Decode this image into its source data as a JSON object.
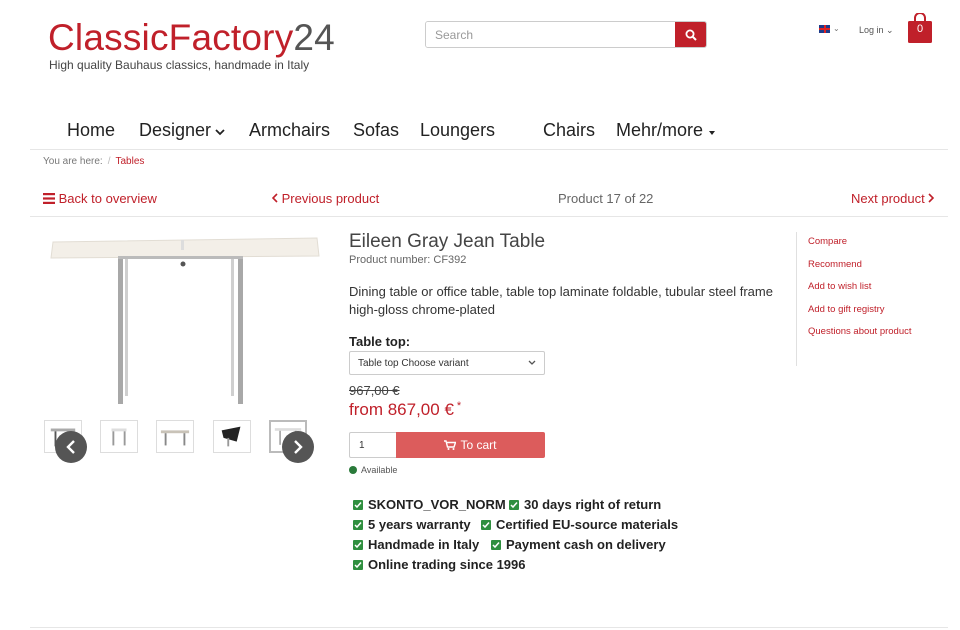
{
  "header": {
    "logo_part1": "Classic",
    "logo_part2": "Factory",
    "logo_part3": "24",
    "tagline": "High quality Bauhaus classics, handmade in Italy",
    "search_placeholder": "Search",
    "language_caret": "⌄",
    "login_label": "Log in ⌄",
    "cart_count": "0"
  },
  "nav": {
    "home": "Home",
    "designer": "Designer",
    "armchairs": "Armchairs",
    "sofas": "Sofas",
    "loungers": "Loungers",
    "chairs": "Chairs",
    "more": "Mehr/more"
  },
  "breadcrumb": {
    "prefix": "You are here:",
    "separator": "/",
    "current": "Tables"
  },
  "pager": {
    "back": "Back to overview",
    "previous": "Previous product",
    "position": "Product 17 of 22",
    "next": "Next product"
  },
  "product": {
    "title": "Eileen Gray Jean Table",
    "number": "Product number: CF392",
    "description": "Dining table or office table, table top laminate foldable, tubular steel frame high-gloss chrome-plated",
    "variant_label": "Table top:",
    "variant_select": "Table top Choose variant",
    "old_price": "967,00 €",
    "price": "from 867,00 €",
    "price_note": "*",
    "quantity": "1",
    "cart_button": "To cart",
    "availability": "Available"
  },
  "features": [
    "SKONTO_VOR_NORM",
    "30 days right of return",
    "5 years warranty",
    "Certified EU-source materials",
    "Handmade in Italy",
    "Payment cash on delivery",
    "Online trading since 1996"
  ],
  "actions": {
    "compare": "Compare",
    "recommend": "Recommend",
    "wishlist": "Add to wish list",
    "gift": "Add to gift registry",
    "questions": "Questions about product"
  },
  "colors": {
    "brand_red": "#c0202a",
    "cart_button": "#dc5c5c",
    "check_green": "#2f8f3f"
  },
  "icons": [
    "search-icon",
    "flag-uk-icon",
    "shopping-bag-icon",
    "chevron-down-icon",
    "menu-list-icon",
    "chevron-left-icon",
    "chevron-right-icon",
    "cart-icon",
    "check-icon"
  ]
}
